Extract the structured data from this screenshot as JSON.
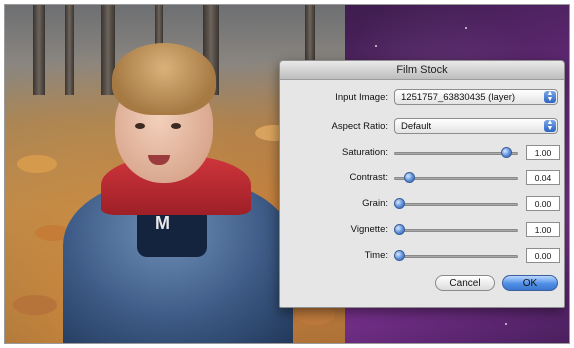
{
  "dialog": {
    "title": "Film Stock",
    "input_image": {
      "label": "Input Image:",
      "value": "1251757_63830435 (layer)"
    },
    "aspect_ratio": {
      "label": "Aspect Ratio:",
      "value": "Default"
    },
    "sliders": [
      {
        "key": "saturation",
        "label": "Saturation:",
        "value": "1.00",
        "level": 0.95
      },
      {
        "key": "contrast",
        "label": "Contrast:",
        "value": "0.04",
        "level": 0.09
      },
      {
        "key": "grain",
        "label": "Grain:",
        "value": "0.00",
        "level": 0.0
      },
      {
        "key": "vignette",
        "label": "Vignette:",
        "value": "1.00",
        "level": 0.0
      },
      {
        "key": "time",
        "label": "Time:",
        "value": "0.00",
        "level": 0.0
      }
    ],
    "cancel_label": "Cancel",
    "ok_label": "OK"
  },
  "photo": {
    "shirt_letter": "M"
  },
  "colors": {
    "accent_blue": "#4f8fe6",
    "desktop_purple": "#6a2b7e"
  }
}
